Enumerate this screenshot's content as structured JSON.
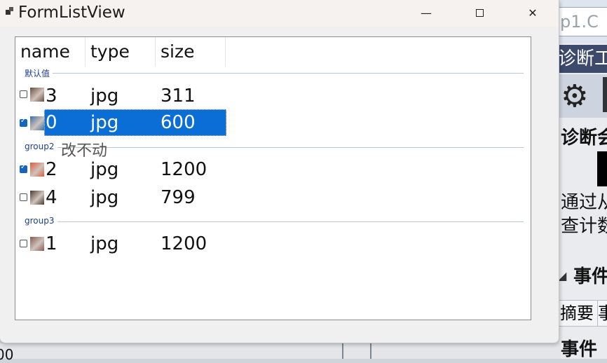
{
  "window": {
    "title": "FormListView",
    "minimize_glyph": "—",
    "close_glyph": "✕"
  },
  "listview": {
    "columns": [
      "name",
      "type",
      "size"
    ],
    "groups": [
      {
        "label": "默认值",
        "rows": [
          {
            "name": "3",
            "type": "jpg",
            "size": "311",
            "checked": false,
            "selected": false,
            "thumb_color": "#6d4a3e"
          },
          {
            "name": "0",
            "type": "jpg",
            "size": "600",
            "checked": true,
            "selected": true,
            "thumb_color": "#3a6fa8"
          }
        ]
      },
      {
        "label": "group2",
        "rows": [
          {
            "name": "2",
            "type": "jpg",
            "size": "1200",
            "checked": true,
            "selected": false,
            "thumb_color": "#e05a3a"
          },
          {
            "name": "4",
            "type": "jpg",
            "size": "799",
            "checked": false,
            "selected": false,
            "thumb_color": "#4a3a34"
          }
        ]
      },
      {
        "label": "group3",
        "rows": [
          {
            "name": "1",
            "type": "jpg",
            "size": "1200",
            "checked": false,
            "selected": false,
            "thumb_color": "#8a5a50"
          }
        ]
      }
    ],
    "edit_hint": "改不动"
  },
  "background_app": {
    "tab_text": "p1.C",
    "band_text": "诊断工",
    "section_text": "诊断会",
    "line1": "通过从",
    "line2": "查计数",
    "event_header": "事件",
    "tab_summary": "摘要",
    "tab_next": "事",
    "event_footer": "事件",
    "bottom_left": "00"
  },
  "colors": {
    "selection": "#0a6ed6",
    "group_label": "#1e3f8c",
    "checkbox_checked": "#1565c0"
  }
}
